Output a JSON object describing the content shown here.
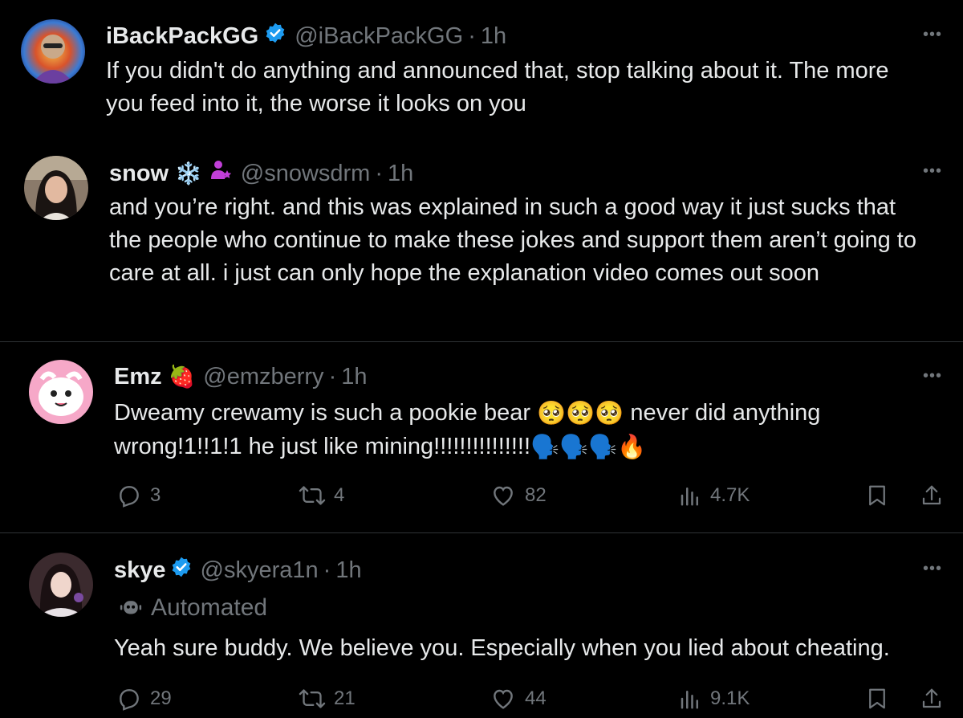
{
  "tweets": [
    {
      "name": "iBackPackGG",
      "handle": "@iBackPackGG",
      "time": "1h",
      "verified": true,
      "text": "If you didn't do anything and announced that, stop talking about it. The more you feed into it, the worse it looks on you"
    },
    {
      "name": "snow",
      "name_emoji": "❄️",
      "handle": "@snowsdrm",
      "time": "1h",
      "text": "and you’re right. and this was explained in such a good way it just sucks that the people who continue to make these jokes and support them aren’t going to care at all. i just can only hope the explanation video comes out soon"
    },
    {
      "name": "Emz",
      "name_emoji": "🍓",
      "handle": "@emzberry",
      "time": "1h",
      "text_part1": "Dweamy crewamy is such a pookie bear ",
      "text_emojis1": "🥺🥺🥺",
      "text_part2": " never did anything wrong!1!!1!1 he just like mining!!!!!!!!!!!!!!!",
      "text_emojis2": "🗣️🗣️🗣️🔥",
      "replies": "3",
      "reposts": "4",
      "likes": "82",
      "views": "4.7K"
    },
    {
      "name": "skye",
      "handle": "@skyera1n",
      "time": "1h",
      "verified": true,
      "automated_label": "Automated",
      "text": "Yeah sure buddy. We believe you. Especially when you lied about cheating.",
      "replies": "29",
      "reposts": "21",
      "likes": "44",
      "views": "9.1K"
    }
  ],
  "dot": "·",
  "more_label": "•••",
  "colors": {
    "verified": "#1d9bf0",
    "muted": "#71767b",
    "text": "#e7e9ea",
    "divider": "#2f3336"
  }
}
